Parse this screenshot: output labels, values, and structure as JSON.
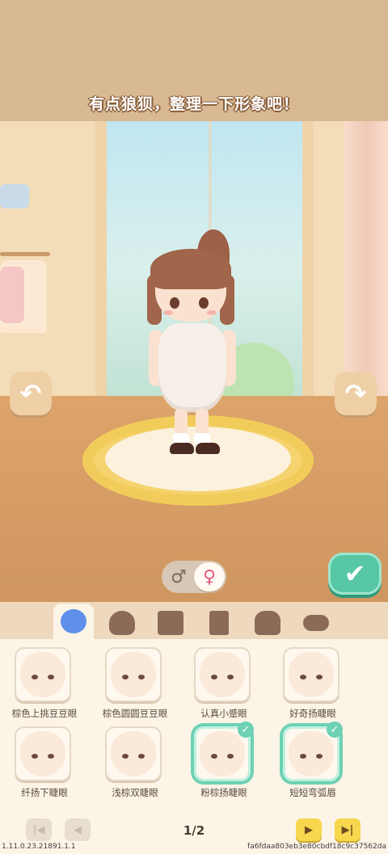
{
  "header": {
    "title": "有点狼狈，整理一下形象吧！"
  },
  "controls": {
    "rotate_left_icon": "rotate-left-arrow",
    "rotate_right_icon": "rotate-right-arrow",
    "gender_male": "♂",
    "gender_female": "♀",
    "gender_selected": "female",
    "confirm_glyph": "✔"
  },
  "tabs": [
    {
      "name": "face",
      "active": true
    },
    {
      "name": "hair",
      "active": false
    },
    {
      "name": "top",
      "active": false
    },
    {
      "name": "pants",
      "active": false
    },
    {
      "name": "dress",
      "active": false
    },
    {
      "name": "shoes",
      "active": false
    }
  ],
  "items": [
    {
      "label": "棕色上挑豆豆眼",
      "selected": false
    },
    {
      "label": "棕色圆圆豆豆眼",
      "selected": false
    },
    {
      "label": "认真小蹙眼",
      "selected": false
    },
    {
      "label": "好奇扬睫眼",
      "selected": false
    },
    {
      "label": "纤扬下睫眼",
      "selected": false
    },
    {
      "label": "浅棕双睫眼",
      "selected": false
    },
    {
      "label": "粉棕扬睫眼",
      "selected": true
    },
    {
      "label": "短短弯弧眉",
      "selected": true
    }
  ],
  "pager": {
    "first": "|◀",
    "prev": "◀",
    "next": "▶",
    "last": "▶|",
    "page_indicator": "1/2"
  },
  "footer": {
    "version": "1.11.0.23.21891.1.1",
    "hash": "fa6fdaa803eb3e80cbdf18c9c37562da"
  },
  "colors": {
    "accent_green": "#58c7a6",
    "selected_border": "#6dd1b3",
    "female_pink": "#e35a7a",
    "active_tab_blue": "#5f8fe8",
    "pager_yellow": "#f6d74e"
  }
}
